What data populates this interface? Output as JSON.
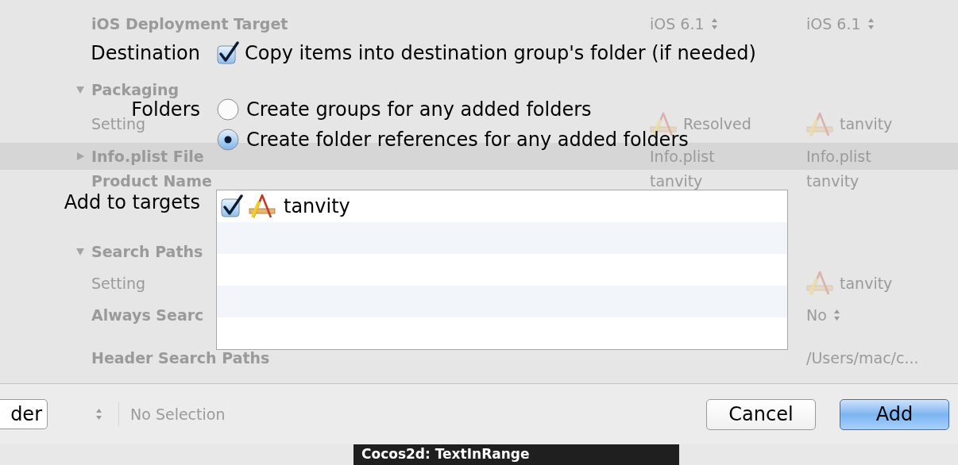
{
  "build_settings": {
    "rows": [
      {
        "kind": "setting",
        "name": "iOS Deployment Target",
        "selected": false,
        "column_2": {
          "text": "iOS 6.1",
          "kind": "popup"
        },
        "column_3": {
          "text": "iOS 6.1",
          "kind": "popup"
        }
      },
      {
        "kind": "section",
        "name": "Packaging",
        "expanded": true,
        "selected": false
      },
      {
        "kind": "header",
        "name": "Setting",
        "selected": false,
        "column_2": {
          "text": "Resolved",
          "kind": "target"
        },
        "column_3": {
          "text": "tanvity",
          "kind": "target"
        }
      },
      {
        "kind": "section",
        "name": "Info.plist File",
        "expanded": false,
        "selected": true,
        "column_2": {
          "text": "Info.plist",
          "kind": "plain"
        },
        "column_3": {
          "text": "Info.plist",
          "kind": "plain"
        }
      },
      {
        "kind": "setting",
        "name": "Product Name",
        "selected": false,
        "column_2": {
          "text": "tanvity",
          "kind": "plain"
        },
        "column_3": {
          "text": "tanvity",
          "kind": "plain"
        }
      },
      {
        "kind": "section",
        "name": "Search Paths",
        "expanded": true,
        "selected": false
      },
      {
        "kind": "header",
        "name": "Setting",
        "selected": false,
        "column_3": {
          "text": "tanvity",
          "kind": "target"
        }
      },
      {
        "kind": "setting",
        "name": "Always Searc",
        "selected": false,
        "column_3": {
          "text": "No",
          "kind": "popup"
        }
      },
      {
        "kind": "setting",
        "name": "Header Search Paths",
        "selected": false,
        "column_3": {
          "text": "/Users/mac/c...",
          "kind": "plain"
        }
      }
    ]
  },
  "sheet": {
    "destination": {
      "label": "Destination",
      "option": {
        "label": "Copy items into destination group's folder (if needed)",
        "checked": true
      }
    },
    "folders": {
      "label": "Folders",
      "options": [
        {
          "label": "Create groups for any added folders",
          "selected": false
        },
        {
          "label": "Create folder references for any added folders",
          "selected": true
        }
      ]
    },
    "targets": {
      "label": "Add to targets",
      "items": [
        {
          "name": "tanvity",
          "checked": true
        }
      ]
    },
    "buttons": [
      {
        "label": "Cancel",
        "kind": "normal"
      },
      {
        "label": "Add",
        "kind": "default"
      }
    ]
  },
  "bottom_bar": {
    "partial_button": "der",
    "selection": "No Selection"
  },
  "console": {
    "text": "Cocos2d: TextInRange"
  }
}
